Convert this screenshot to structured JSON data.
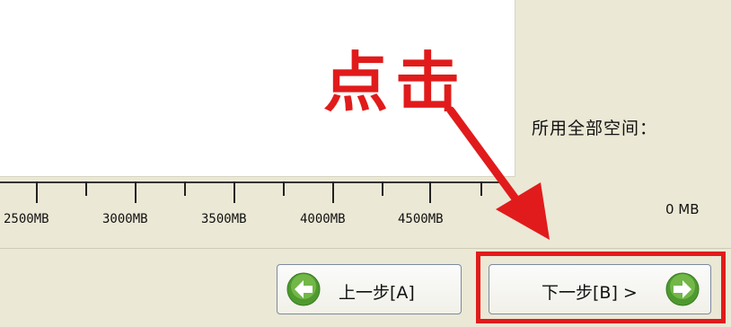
{
  "panel": {
    "space_label": "所用全部空间：",
    "space_value": "0 MB"
  },
  "ruler": {
    "labels": [
      "2500MB",
      "3000MB",
      "3500MB",
      "4000MB",
      "4500MB"
    ]
  },
  "annotation": {
    "text": "点击",
    "color": "#e11b1b"
  },
  "buttons": {
    "prev_label": "上一步[A]",
    "next_label": "下一步[B] >"
  },
  "icons": {
    "prev": "arrow-left-icon",
    "next": "arrow-right-icon"
  }
}
